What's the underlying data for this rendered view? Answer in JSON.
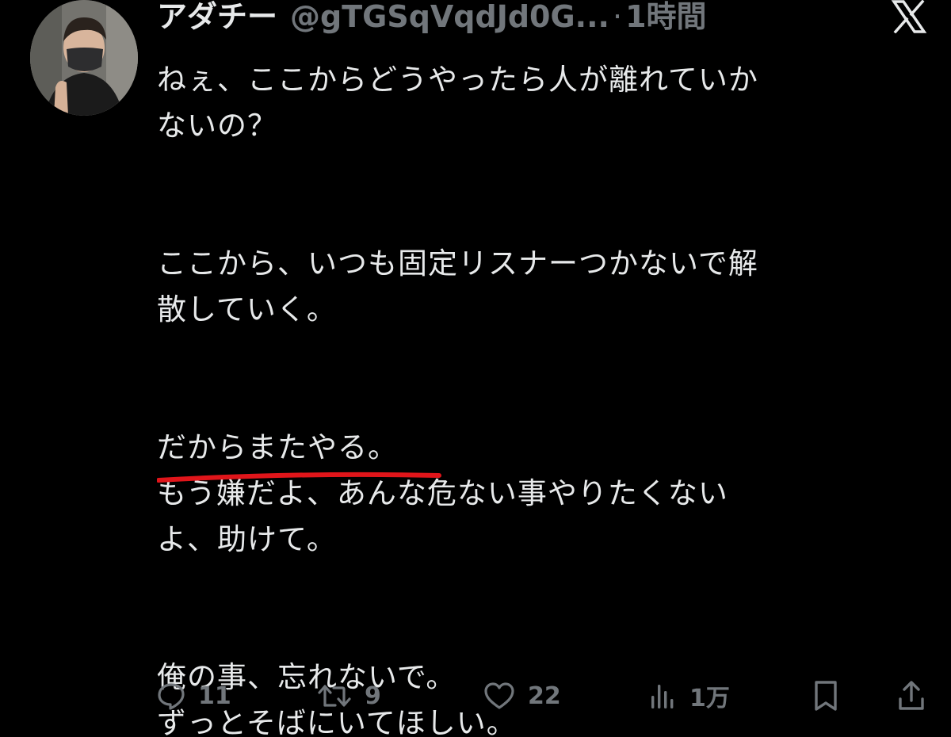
{
  "post": {
    "author_name": "アダチー",
    "handle": "@gTGSqVqdJd0G...",
    "separator": "·",
    "time": "1時間",
    "lines": [
      "ねぇ、ここからどうやったら人が離れていか",
      "ないの？",
      "ここから、いつも固定リスナーつかないで解",
      "散していく。",
      "だからまたやる。",
      "もう嫌だよ、あんな危ない事やりたくない",
      "よ、助けて。",
      "俺の事、忘れないで。",
      "ずっとそばにいてほしい。"
    ],
    "underline_color": "#e0151a"
  },
  "actions": {
    "reply_count": "11",
    "repost_count": "9",
    "like_count": "22",
    "views_count": "1万"
  },
  "colors": {
    "background": "#000000",
    "text": "#e7e9ea",
    "muted": "#71767b"
  },
  "icons": [
    "x-logo-icon",
    "reply-icon",
    "repost-icon",
    "like-icon",
    "views-icon",
    "bookmark-icon",
    "share-icon"
  ]
}
